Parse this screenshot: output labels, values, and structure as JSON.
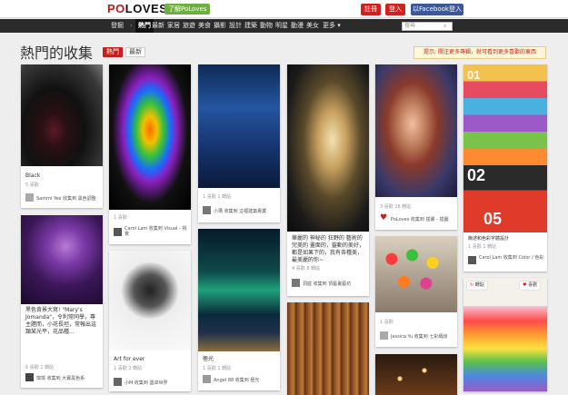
{
  "header": {
    "logo_a": "PO",
    "logo_b": "LOVES",
    "badge": "了解PoLoves",
    "register": "註冊",
    "login": "登入",
    "facebook": "以Facebook登入"
  },
  "nav": {
    "discover": "發掘",
    "sep": "›",
    "items": [
      "熱門",
      "最新",
      "家居",
      "旅遊",
      "美食",
      "攝影",
      "設計",
      "建築",
      "動物",
      "明星",
      "動漫",
      "美女",
      "更多 ▾"
    ],
    "search_placeholder": "搜尋"
  },
  "page": {
    "title": "熱門的收集",
    "tab_hot": "熱門",
    "tab_new": "最新",
    "tip": "提示: 關注更多專輯，就可看到更多喜歡的東西"
  },
  "cards": {
    "c1": {
      "title": "Black",
      "stats": "5 喜歡",
      "user": "Sammi Yee 收集到 黑色調整"
    },
    "c2": {
      "title": "黑色背景大寫! \"Mary's Jomanda\"，令利常同學，專主題而，小花長坦，常報出這類某光平，花品種...",
      "stats": "6 喜歡  1 轉貼",
      "user": "琪琪 收集到 大寶黑色系"
    },
    "c3": {
      "stats": "1 喜歡",
      "user": "Carol Lam 收集到 Visual - 視覺"
    },
    "c4": {
      "title": "Art for ever",
      "stats": "1 喜歡  2 轉貼",
      "user": "小M 收集到 盡卓世界"
    },
    "c5": {
      "stats": "1 喜歡  1 轉貼",
      "user": "小瑪 收集到 這裡建築專業"
    },
    "c6": {
      "title": "極光",
      "stats": "1 喜歡  1 轉貼",
      "user": "Angel 88 收集到 極光"
    },
    "c7": {
      "title": "華麗的 神秘的 狂野的 藝術的 完美的 畫面的，靈動的美好，都是如果下的，我有各種美，最美麗的你~",
      "stats": "4 喜歡  8 轉貼",
      "user": "洞庭 收集到 頂藝畫藝坊"
    },
    "c8": {
      "stats": "3 喜歡  28 轉貼",
      "user": "PoLoves 收集到 插畫 - 插圖"
    },
    "c9": {
      "stats": "1 喜歡",
      "user": "Jessica Yu 收集到 七彩繽紛"
    },
    "c10": {
      "title": "簡述和色彩字體設計",
      "stats": "1 喜歡  1 轉貼",
      "user": "Carol Lam 收集到 Color / 色彩",
      "num_a": "01",
      "num_b": "02",
      "num_c": "05",
      "btn_repin": "轉貼",
      "btn_like": "喜歡"
    }
  },
  "colors": {
    "accent": "#c81e1e",
    "facebook": "#3b5998",
    "nav": "#2b2b2b",
    "green": "#6ab23a"
  }
}
